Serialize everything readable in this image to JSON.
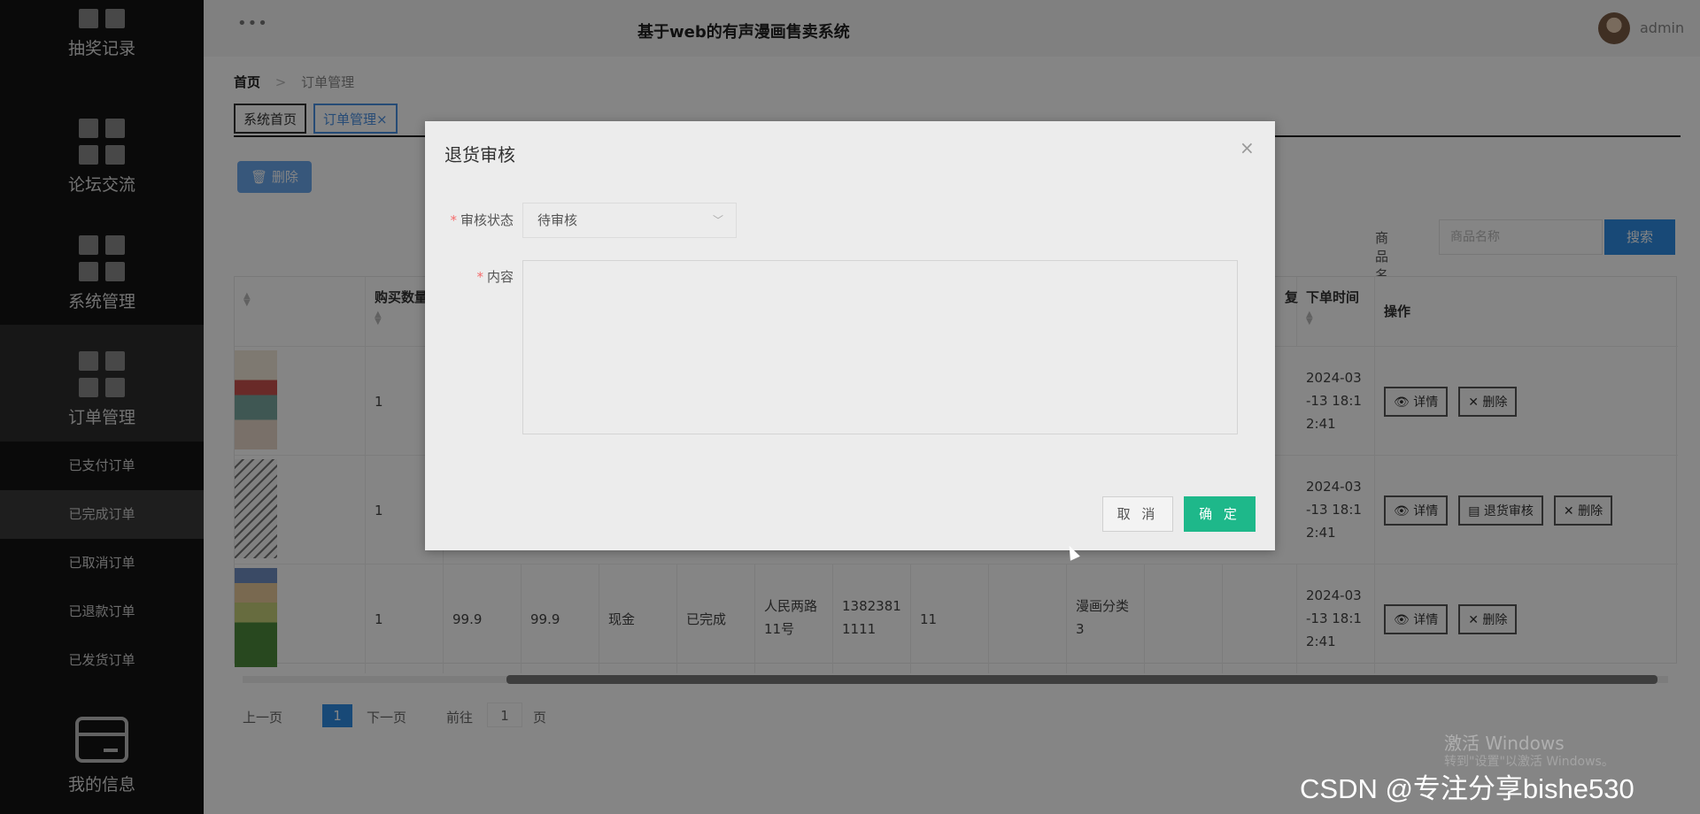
{
  "app": {
    "title": "基于web的有声漫画售卖系统",
    "user": "admin",
    "menu_dots": "•••"
  },
  "sidebar": {
    "groups": [
      {
        "label": "抽奖记录",
        "icon": "grid-icon"
      },
      {
        "label": "论坛交流",
        "icon": "grid-icon"
      },
      {
        "label": "系统管理",
        "icon": "grid-icon"
      },
      {
        "label": "订单管理",
        "icon": "grid-icon"
      }
    ],
    "subitems": [
      "已支付订单",
      "已完成订单",
      "已取消订单",
      "已退款订单",
      "已发货订单"
    ],
    "bottom": {
      "label": "我的信息",
      "icon": "card-icon"
    }
  },
  "breadcrumb": {
    "home": "首页",
    "sep": ">",
    "current": "订单管理"
  },
  "tabs": [
    {
      "label": "系统首页"
    },
    {
      "label": "订单管理×"
    }
  ],
  "toolbar": {
    "delete_label": "🗑 删除"
  },
  "search": {
    "label": "商品名称",
    "placeholder": "商品名称",
    "button": "搜索"
  },
  "table": {
    "headers": {
      "qty": "购买数量",
      "fu": "复",
      "order_time": "下单时间",
      "ops": "操作"
    },
    "rows": [
      {
        "qty": "1",
        "date1": "2024-03",
        "date2": "-13 18:1",
        "date3": "2:41",
        "actions": [
          "👁 详情",
          "✕ 删除"
        ]
      },
      {
        "qty": "1",
        "date1": "2024-03",
        "date2": "-13 18:1",
        "date3": "2:41",
        "actions": [
          "👁 详情",
          "▤ 退货审核",
          "✕ 删除"
        ]
      },
      {
        "qty": "1",
        "price": "99.9",
        "total": "99.9",
        "pay": "现金",
        "status": "已完成",
        "addr1": "人民两路",
        "addr2": "11号",
        "phone1": "1382381",
        "phone2": "1111",
        "num": "11",
        "cat1": "漫画分类",
        "cat2": "3",
        "date1": "2024-03",
        "date2": "-13 18:1",
        "date3": "2:41",
        "actions": [
          "👁 详情",
          "✕ 删除"
        ]
      }
    ]
  },
  "pager": {
    "prev": "上一页",
    "current": "1",
    "next": "下一页",
    "goto": "前往",
    "page_input": "1",
    "page_unit": "页"
  },
  "modal": {
    "title": "退货审核",
    "close": "×",
    "status_label": "审核状态",
    "status_value": "待审核",
    "content_label": "内容",
    "required_mark": "*",
    "cancel": "取 消",
    "ok": "确 定"
  },
  "watermarks": {
    "win1": "激活 Windows",
    "win2": "转到\"设置\"以激活 Windows。",
    "csdn": "CSDN @专注分享bishe530"
  }
}
